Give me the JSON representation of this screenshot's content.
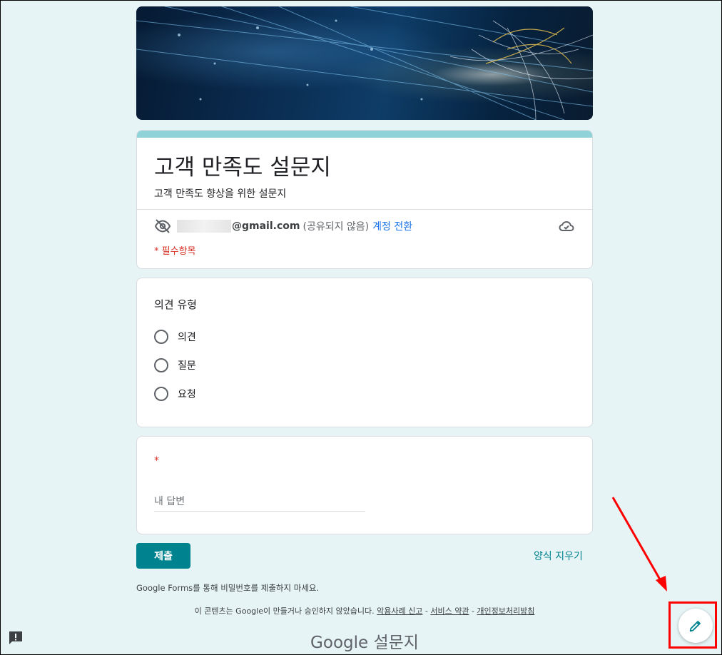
{
  "form": {
    "title": "고객 만족도 설문지",
    "description": "고객 만족도 향상을 위한 설문지",
    "account": {
      "email_suffix": "@gmail.com",
      "not_shared": "(공유되지 않음)",
      "switch_label": "계정 전환"
    },
    "required_note": "* 필수항목"
  },
  "questions": [
    {
      "title": "의견 유형",
      "options": [
        "의견",
        "질문",
        "요청"
      ]
    },
    {
      "required_mark": "*",
      "placeholder": "내 답변"
    }
  ],
  "actions": {
    "submit_label": "제출",
    "clear_label": "양식 지우기"
  },
  "footer": {
    "password_note": "Google Forms를 통해 비밀번호를 제출하지 마세요.",
    "disclaimer": "이 콘텐츠는 Google이 만들거나 승인하지 않았습니다.",
    "sep": " - ",
    "links": [
      "악용사례 신고",
      "서비스 약관",
      "개인정보처리방침"
    ],
    "brand": "Google 설문지"
  },
  "colors": {
    "accent": "#00838f",
    "title_bar": "#8fd3d8",
    "background": "#e6f4f6",
    "required": "#d93025",
    "link": "#1a73e8",
    "highlight": "#ff0000"
  },
  "icons": [
    "eye-off-icon",
    "cloud-check-icon",
    "feedback-icon",
    "pencil-icon"
  ]
}
